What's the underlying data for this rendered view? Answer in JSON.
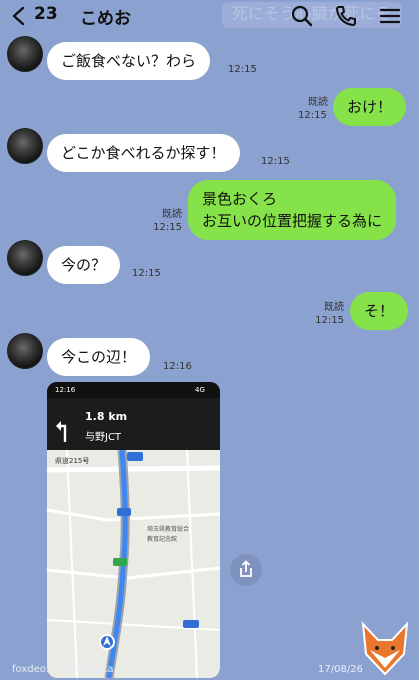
{
  "header": {
    "unread_count": "23",
    "title": "こめお",
    "ghost_text": "死にそう心臓が死にそ"
  },
  "messages": [
    {
      "id": "m1",
      "side": "in",
      "text": "ご飯食べない？わら",
      "time": "12:15"
    },
    {
      "id": "m2",
      "side": "out",
      "text": "おけ！",
      "read": "既読",
      "time": "12:15"
    },
    {
      "id": "m3",
      "side": "in",
      "text": "どこか食べれるか探す！",
      "time": "12:15"
    },
    {
      "id": "m4",
      "side": "out",
      "lines": [
        "景色おくろ",
        "お互いの位置把握する為に"
      ],
      "read": "既読",
      "time": "12:15"
    },
    {
      "id": "m5",
      "side": "in",
      "text": "今の？",
      "time": "12:15"
    },
    {
      "id": "m6",
      "side": "out",
      "text": "そ！",
      "read": "既読",
      "time": "12:15"
    },
    {
      "id": "m7",
      "side": "in",
      "text": "今この辺！",
      "time": "12:16"
    }
  ],
  "shared_screenshot": {
    "status_time": "12:16",
    "network": "4G",
    "distance": "1.8 km",
    "junction": "与野JCT",
    "road_label": "県道215号",
    "route_number": "215",
    "poi_1": "埼玉県教育総合",
    "poi_2": "教育記念館"
  },
  "watermark": "foxdeo.com/renkuka...",
  "date_stamp": "17/08/26",
  "colors": {
    "background": "#8ba1cf",
    "incoming_bubble": "#ffffff",
    "outgoing_bubble": "#85e249"
  }
}
